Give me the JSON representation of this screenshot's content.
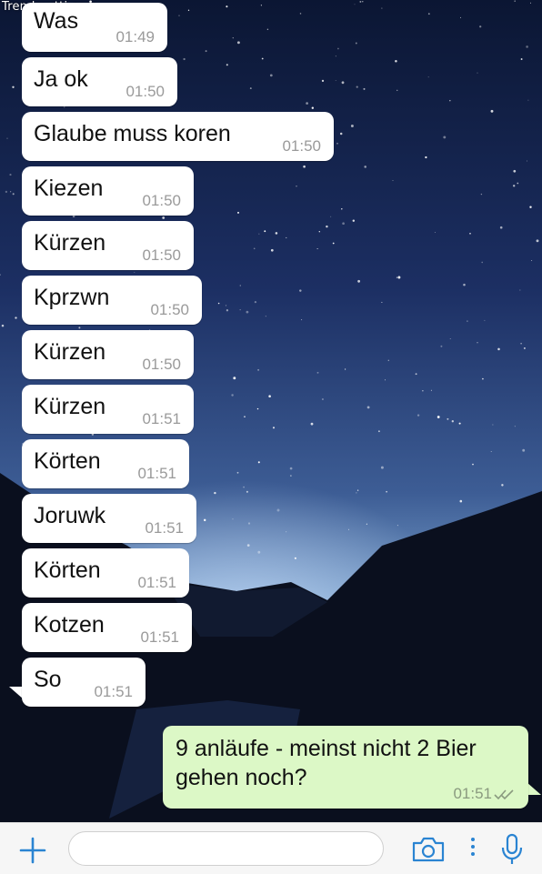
{
  "watermark": "Trendmutti.com",
  "messages": [
    {
      "text": "Was",
      "time": "01:49"
    },
    {
      "text": "Ja ok",
      "time": "01:50"
    },
    {
      "text": "Glaube muss koren",
      "time": "01:50"
    },
    {
      "text": "Kiezen",
      "time": "01:50"
    },
    {
      "text": "Kürzen",
      "time": "01:50"
    },
    {
      "text": "Kprzwn",
      "time": "01:50"
    },
    {
      "text": "Kürzen",
      "time": "01:50"
    },
    {
      "text": "Kürzen",
      "time": "01:51"
    },
    {
      "text": "Körten",
      "time": "01:51"
    },
    {
      "text": "Joruwk",
      "time": "01:51"
    },
    {
      "text": "Körten",
      "time": "01:51"
    },
    {
      "text": "Kotzen",
      "time": "01:51"
    },
    {
      "text": "So",
      "time": "01:51"
    }
  ],
  "outgoing": {
    "text": "9 anläufe - meinst nicht 2 Bier gehen noch?",
    "time": "01:51",
    "status": "read-double-check"
  },
  "input_bar": {
    "icons": [
      "plus-icon",
      "camera-icon",
      "more-dots-icon",
      "microphone-icon"
    ],
    "placeholder": ""
  },
  "colors": {
    "incoming_bubble": "#ffffff",
    "outgoing_bubble": "#dcf8c6",
    "timestamp": "#9a9a9a",
    "accent": "#2a84d2"
  }
}
